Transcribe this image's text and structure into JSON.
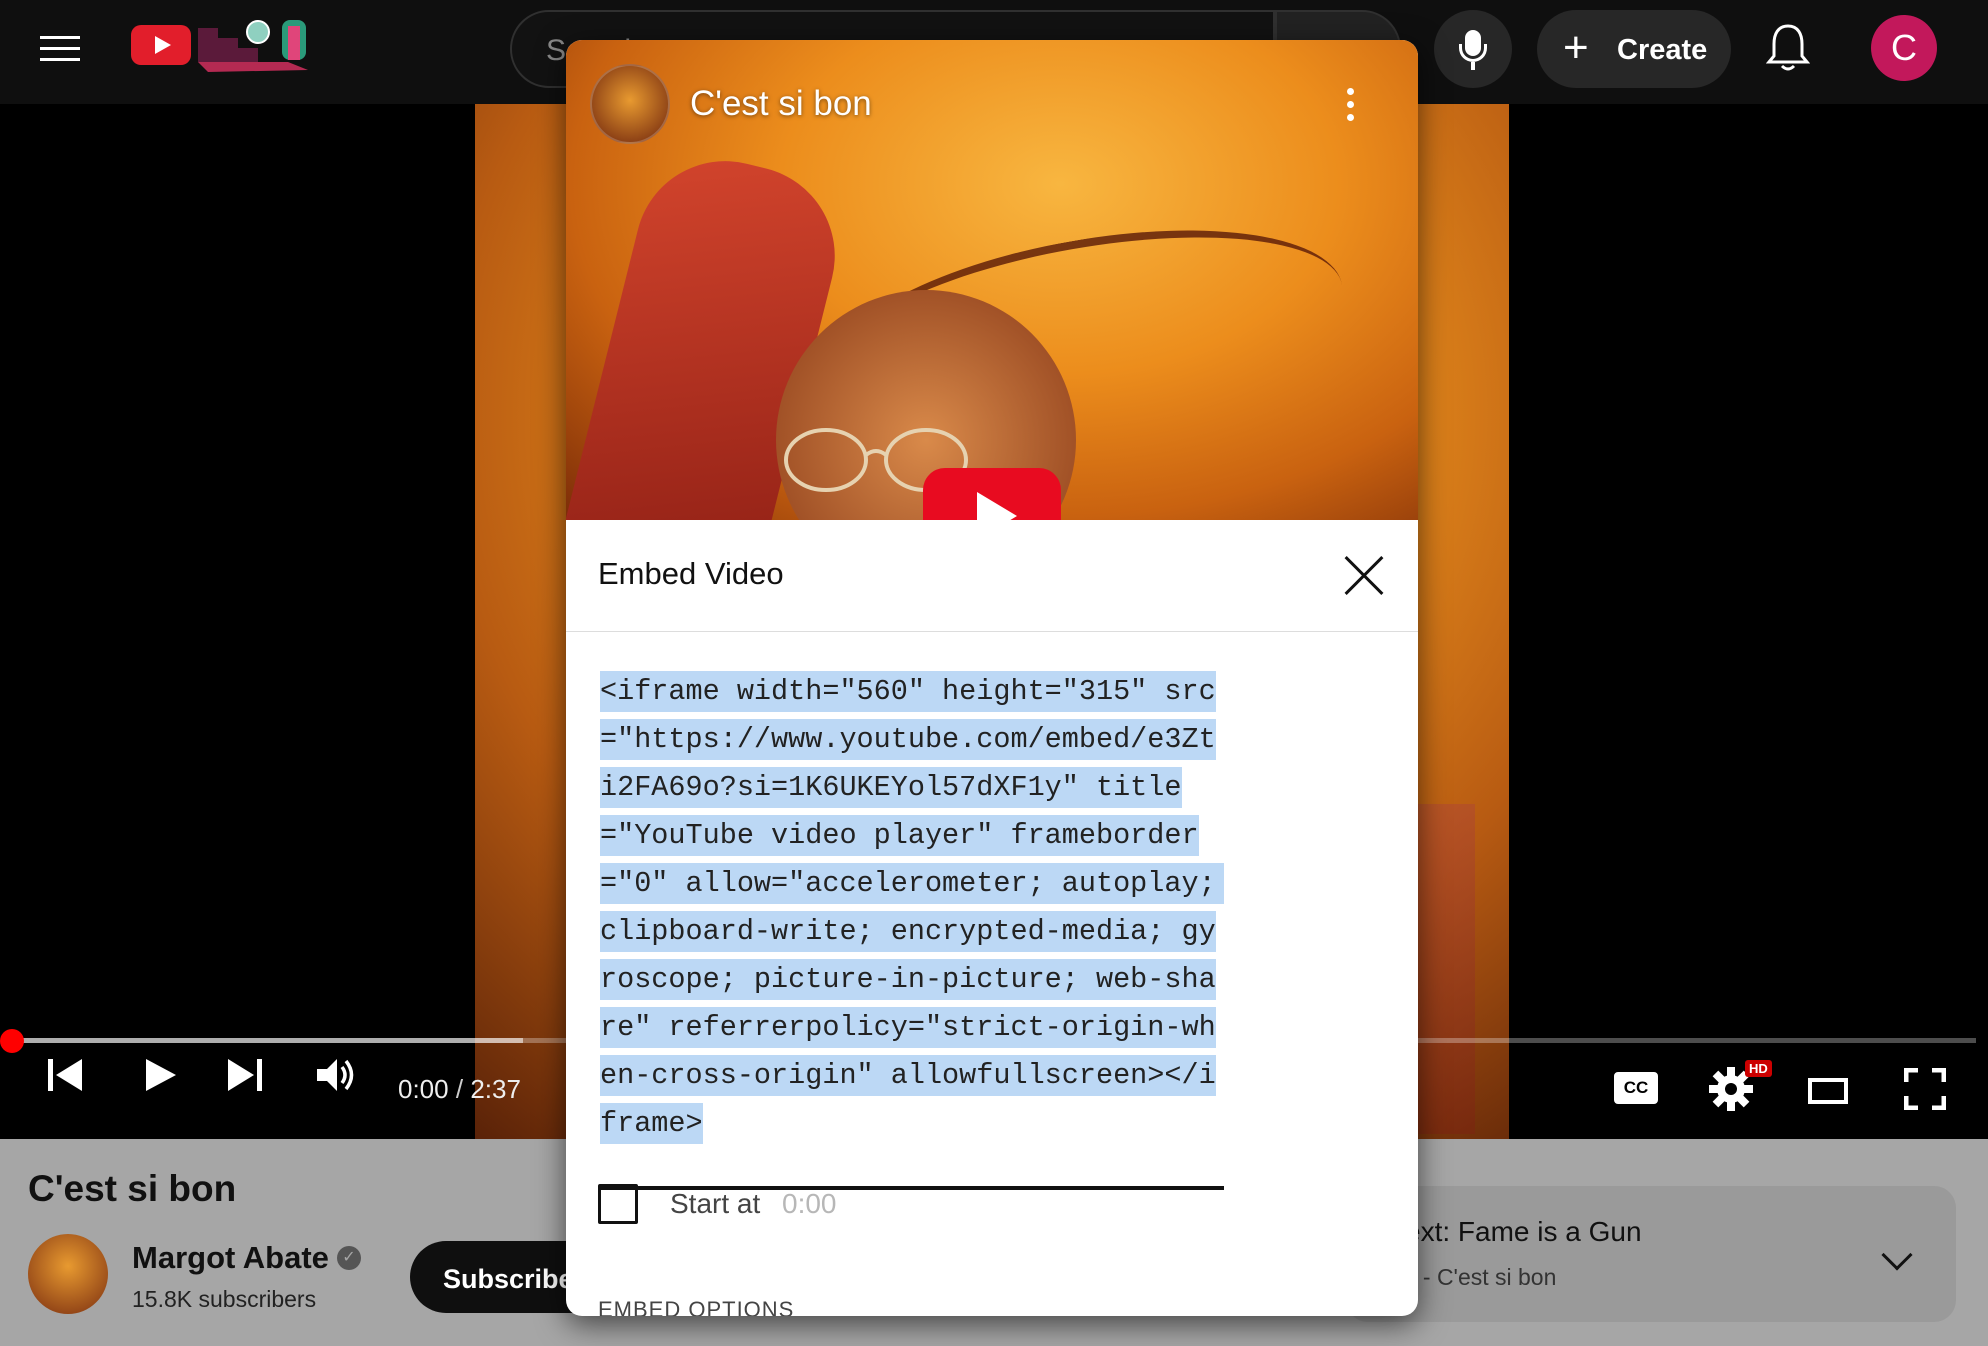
{
  "masthead": {
    "search_placeholder": "Search",
    "create_label": "Create",
    "avatar_letter": "C"
  },
  "player": {
    "current_time": "0:00",
    "separator": "/",
    "duration": "2:37",
    "buffered_fraction": 0.26,
    "hd_badge": "HD",
    "cc_label": "CC"
  },
  "video": {
    "title": "C'est si bon",
    "channel": "Margot Abate",
    "subscribers": "15.8K subscribers",
    "subscribe_label": "Subscribe"
  },
  "up_next": {
    "title": "ext: Fame is a Gun",
    "subtitle": "x - C'est si bon"
  },
  "modal": {
    "preview_title": "C'est si bon",
    "heading": "Embed Video",
    "embed_code": "<iframe width=\"560\" height=\"315\" src=\"https://www.youtube.com/embed/e3Zti2FA69o?si=1K6UKEYol57dXF1y\" title=\"YouTube video player\" frameborder=\"0\" allow=\"accelerometer; autoplay; clipboard-write; encrypted-media; gyroscope; picture-in-picture; web-share\" referrerpolicy=\"strict-origin-when-cross-origin\" allowfullscreen></iframe>",
    "start_at_label": "Start at",
    "start_at_value": "0:00",
    "options_label": "EMBED OPTIONS"
  },
  "colors": {
    "brand_red": "#e21e2b",
    "selection": "#bcd8f5",
    "avatar": "#c2185b"
  }
}
